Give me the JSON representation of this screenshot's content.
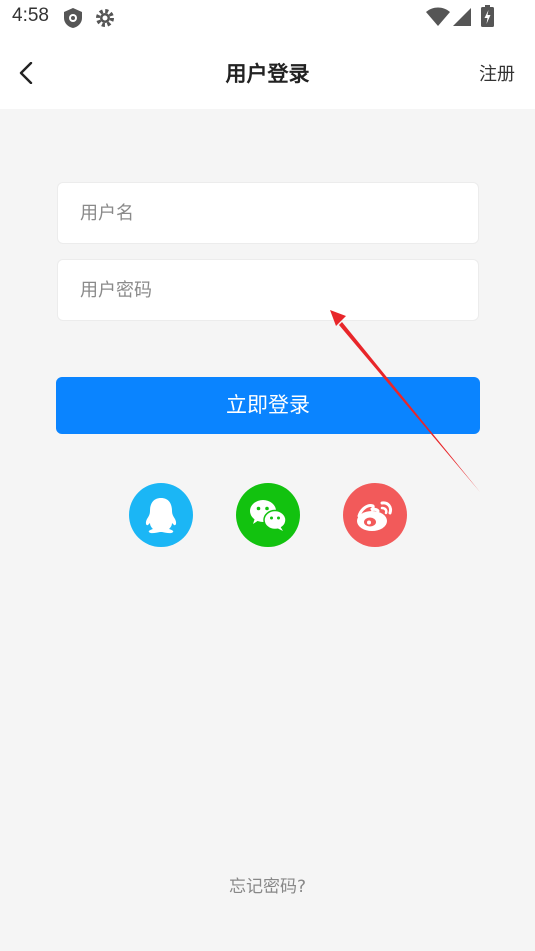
{
  "status_bar": {
    "time": "4:58",
    "icons": [
      "shield-icon",
      "gear-icon",
      "wifi-icon",
      "signal-icon",
      "battery-icon"
    ]
  },
  "nav": {
    "back_icon": "chevron-left-icon",
    "title": "用户登录",
    "register_label": "注册"
  },
  "form": {
    "username": {
      "value": "",
      "placeholder": "用户名"
    },
    "password": {
      "value": "",
      "placeholder": "用户密码"
    },
    "login_label": "立即登录"
  },
  "social": [
    {
      "name": "QQ",
      "icon": "qq-icon",
      "color": "#1bb6f5"
    },
    {
      "name": "WeChat",
      "icon": "wechat-icon",
      "color": "#12c20f"
    },
    {
      "name": "Weibo",
      "icon": "weibo-icon",
      "color": "#f25a5a"
    }
  ],
  "forgot_label": "忘记密码?",
  "colors": {
    "primary": "#0a84ff",
    "background": "#f5f5f5",
    "annotation": "#e8262a"
  }
}
